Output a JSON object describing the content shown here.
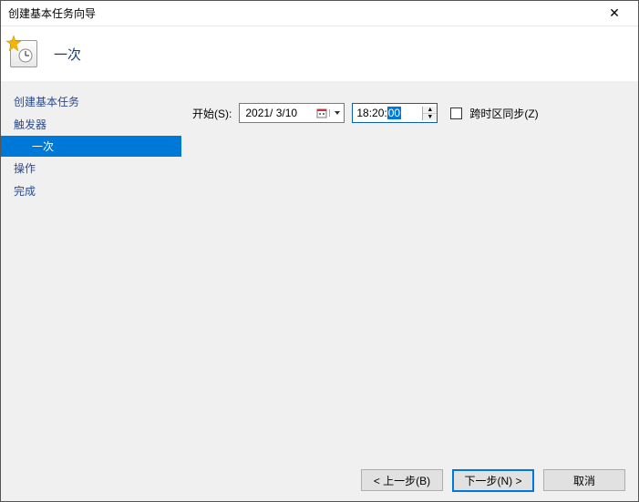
{
  "window": {
    "title": "创建基本任务向导",
    "close": "✕"
  },
  "header": {
    "title": "一次"
  },
  "sidebar": {
    "items": [
      {
        "label": "创建基本任务",
        "sub": false,
        "selected": false
      },
      {
        "label": "触发器",
        "sub": false,
        "selected": false
      },
      {
        "label": "一次",
        "sub": true,
        "selected": true
      },
      {
        "label": "操作",
        "sub": false,
        "selected": false
      },
      {
        "label": "完成",
        "sub": false,
        "selected": false
      }
    ]
  },
  "form": {
    "start_label": "开始(S):",
    "date_value": "2021/ 3/10",
    "time_prefix": "18:20:",
    "time_selected": "00",
    "sync_label": "跨时区同步(Z)",
    "sync_checked": false
  },
  "footer": {
    "back": "< 上一步(B)",
    "next": "下一步(N) >",
    "cancel": "取消"
  }
}
